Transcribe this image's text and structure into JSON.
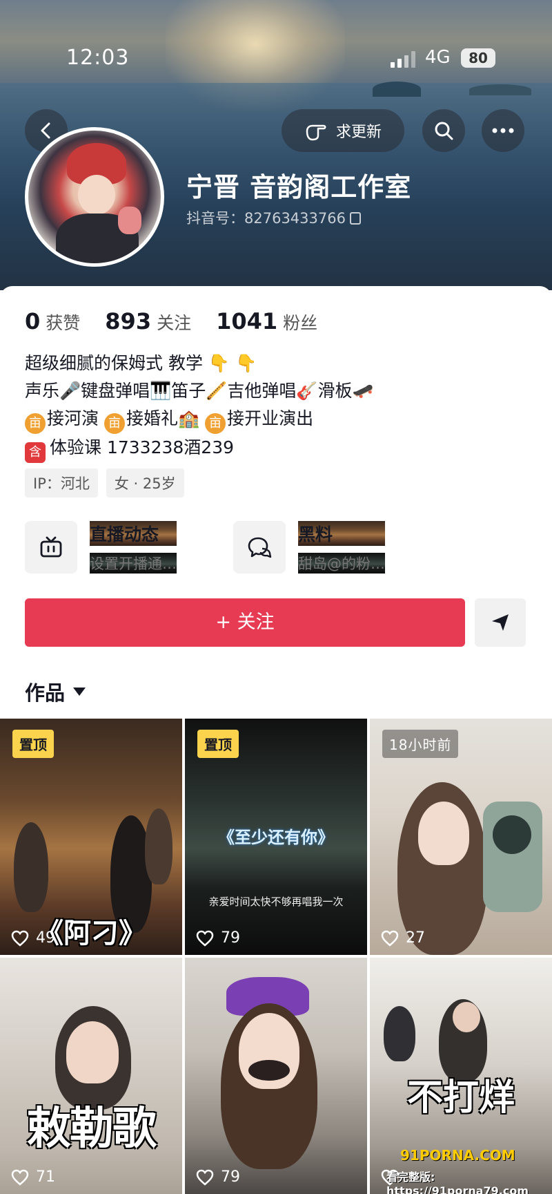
{
  "status_bar": {
    "time": "12:03",
    "network": "4G",
    "battery": "80"
  },
  "header": {
    "update_label": "求更新",
    "name": "宁晋 音韵阁工作室",
    "douyin_id": "抖音号：82763433766"
  },
  "stats": [
    {
      "num": "0",
      "label": "获赞"
    },
    {
      "num": "893",
      "label": "关注"
    },
    {
      "num": "1041",
      "label": "粉丝"
    }
  ],
  "bio": {
    "line1": "超级细腻的保姆式 教学 👇 👇",
    "line2": "声乐🎤键盘弹唱🎹笛子🪈吉他弹唱🎸滑板🛹",
    "line3a": "接河演",
    "line3b": "接婚礼",
    "line3c": "接开业演出",
    "line3_chip": "亩",
    "line4_chip": "含",
    "line4": "体验课 1733238酒239"
  },
  "tags": {
    "ip": "IP：河北",
    "gender_age": "女 · 25岁"
  },
  "features": {
    "live_title": "直播动态",
    "live_sub": "设置开播通…",
    "chat_title": "黑料",
    "chat_sub": "甜岛@的粉…"
  },
  "follow_label": "+ 关注",
  "works_tab": "作品",
  "tiles": [
    {
      "badge": "置顶",
      "likes": "49",
      "caption": "《阿刁》"
    },
    {
      "badge": "置顶",
      "likes": "79",
      "caption": "《至少还有你》",
      "subcaption": "亲爱时间太快不够再唱我一次"
    },
    {
      "badge": "18小时前",
      "likes": "27"
    },
    {
      "likes": "71",
      "caption": "敕勒歌"
    },
    {
      "likes": "79"
    },
    {
      "likes": "",
      "caption": "不打烊"
    }
  ],
  "watermark": {
    "brand": "91PORNA.COM",
    "url": "看完整版: https://91porna79.com"
  }
}
